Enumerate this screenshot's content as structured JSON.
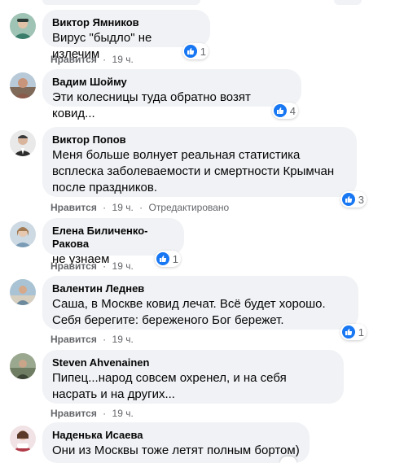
{
  "comments": [
    {
      "author": "Виктор Ямников",
      "text": "Вирус \"быдло\" не излечим",
      "like_label": "Нравится",
      "separator": "·",
      "time": "19 ч.",
      "reaction_count": "1",
      "avatar_color": "#3a7d6b"
    },
    {
      "author": "Вадим Шойму",
      "text": "Эти колесницы туда обратно возят ковид...",
      "like_label": "Нравится",
      "separator": "·",
      "time": "19 ч.",
      "reaction_count": "4",
      "avatar_color": "#8a5a4a"
    },
    {
      "author": "Виктор Попов",
      "text": "Меня больше волнует реальная статистика всплеска заболеваемости и смертности Крымчан после праздников.",
      "like_label": "Нравится",
      "separator": "·",
      "time": "19 ч.",
      "edited": "Отредактировано",
      "reaction_count": "3",
      "avatar_color": "#2b2b2b"
    },
    {
      "author": "Елена Биличенко-Ракова",
      "text": "не узнаем",
      "like_label": "Нравится",
      "separator": "·",
      "time": "19 ч.",
      "reaction_count": "1",
      "avatar_color": "#7a9bb5"
    },
    {
      "author": "Валентин Леднев",
      "text": "Саша, в Москве ковид лечат. Всё будет хорошо. Себя берегите: береженого Бог бережет.",
      "like_label": "Нравится",
      "separator": "·",
      "time": "19 ч.",
      "reaction_count": "1",
      "avatar_color": "#6d8a9c"
    },
    {
      "author": "Steven Ahvenainen",
      "text": "Пипец...народ совсем охренел, и на себя насрать и на других...",
      "like_label": "Нравится",
      "separator": "·",
      "time": "19 ч.",
      "avatar_color": "#5c6b55"
    },
    {
      "author": "Наденька Исаева",
      "text": "Они из Москвы тоже летят полным бортом)",
      "avatar_color": "#b03a48"
    }
  ],
  "colors": {
    "bubble": "#f0f2f5",
    "meta_text": "#65676b",
    "like_blue": "#1877f2"
  }
}
